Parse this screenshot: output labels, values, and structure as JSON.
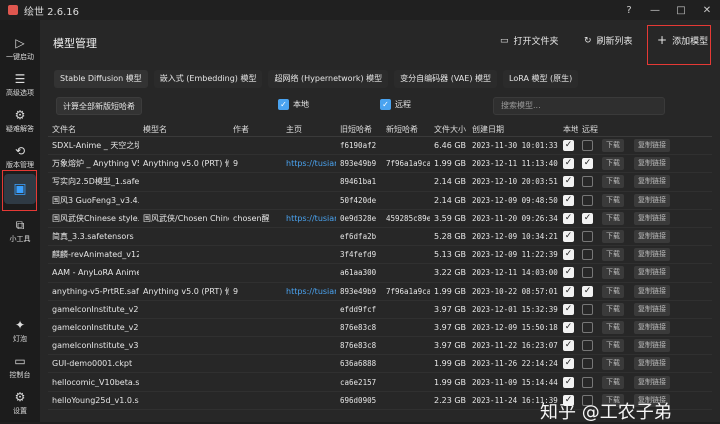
{
  "app": {
    "title": "绘世 2.6.16"
  },
  "window_buttons": [
    "?",
    "—",
    "□",
    "✕"
  ],
  "sidebar": {
    "items": [
      {
        "label": "一键启动",
        "icon": "▷"
      },
      {
        "label": "高级选项",
        "icon": "☰"
      },
      {
        "label": "疑难解答",
        "icon": "⚙"
      },
      {
        "label": "版本管理",
        "icon": "⟲"
      },
      {
        "label": "",
        "icon": "▣"
      },
      {
        "label": "小工具",
        "icon": "⧉"
      }
    ],
    "bottom_items": [
      {
        "label": "灯泡",
        "icon": "✦"
      },
      {
        "label": "控制台",
        "icon": "▭"
      },
      {
        "label": "设置",
        "icon": "⚙"
      }
    ]
  },
  "header": {
    "title": "模型管理",
    "open_folder": "打开文件夹",
    "refresh": "刷新列表",
    "add_model": "添加模型"
  },
  "tabs": [
    "Stable Diffusion 模型",
    "嵌入式 (Embedding) 模型",
    "超网络 (Hypernetwork) 模型",
    "变分自编码器 (VAE) 模型",
    "LoRA 模型 (原生)"
  ],
  "toolbar": {
    "compute_button": "计算全部新版短哈希",
    "local_label": "本地",
    "remote_label": "远程",
    "search_placeholder": "搜索模型..."
  },
  "table": {
    "columns": [
      "文件名",
      "模型名",
      "作者",
      "主页",
      "旧短哈希",
      "新短哈希",
      "文件大小",
      "创建日期",
      "本地",
      "远程",
      "",
      ""
    ],
    "download_label": "下载",
    "copy_label": "复制链接",
    "rows": [
      {
        "file": "SDXL-Anime _ 天空之境",
        "model": "",
        "author": "",
        "home": "",
        "old": "f6190af2",
        "new": "",
        "size": "6.46 GB",
        "date": "2023-11-30 10:01:33",
        "local": true,
        "remote": false
      },
      {
        "file": "万象熔炉 _ Anything V5",
        "model": "Anything v5.0 (PRT) 修复",
        "author": "9",
        "home": "https://tusiart",
        "old": "893e49b9",
        "new": "7f96a1a9ca",
        "size": "1.99 GB",
        "date": "2023-12-11 11:13:40",
        "local": true,
        "remote": true
      },
      {
        "file": "写实向2.5D模型_1.safeten",
        "model": "",
        "author": "",
        "home": "",
        "old": "89461ba1",
        "new": "",
        "size": "2.14 GB",
        "date": "2023-12-10 20:03:51",
        "local": true,
        "remote": false
      },
      {
        "file": "国风3 GuoFeng3_v3.4.saf",
        "model": "",
        "author": "",
        "home": "",
        "old": "50f420de",
        "new": "",
        "size": "2.14 GB",
        "date": "2023-12-09 09:48:50",
        "local": true,
        "remote": false
      },
      {
        "file": "国风武侠Chinese style.ck",
        "model": "国风武侠/Chosen Chine",
        "author": "chosen醒",
        "home": "https://tusiart",
        "old": "0e9d328e",
        "new": "459285c89e",
        "size": "3.59 GB",
        "date": "2023-11-20 09:26:34",
        "local": true,
        "remote": true
      },
      {
        "file": "简真_3.3.safetensors",
        "model": "",
        "author": "",
        "home": "",
        "old": "ef6dfa2b",
        "new": "",
        "size": "5.28 GB",
        "date": "2023-12-09 10:34:21",
        "local": true,
        "remote": false
      },
      {
        "file": "麒麟-revAnimated_v122",
        "model": "",
        "author": "",
        "home": "",
        "old": "3f4fefd9",
        "new": "",
        "size": "5.13 GB",
        "date": "2023-12-09 11:22:39",
        "local": true,
        "remote": false
      },
      {
        "file": "AAM - AnyLoRA Anime",
        "model": "",
        "author": "",
        "home": "",
        "old": "a61aa300",
        "new": "",
        "size": "3.22 GB",
        "date": "2023-12-11 14:03:00",
        "local": true,
        "remote": false
      },
      {
        "file": "anything-v5-PrtRE.safet",
        "model": "Anything v5.0 (PRT) 修复",
        "author": "9",
        "home": "https://tusiart",
        "old": "893e49b9",
        "new": "7f96a1a9ca",
        "size": "1.99 GB",
        "date": "2023-10-22 08:57:01",
        "local": true,
        "remote": true
      },
      {
        "file": "gameIconInstitute_v21.s",
        "model": "",
        "author": "",
        "home": "",
        "old": "efdd9fcf",
        "new": "",
        "size": "3.97 GB",
        "date": "2023-12-01 15:32:39",
        "local": true,
        "remote": false
      },
      {
        "file": "gameIconInstitute_v22.s",
        "model": "",
        "author": "",
        "home": "",
        "old": "876e83c8",
        "new": "",
        "size": "3.97 GB",
        "date": "2023-12-09 15:50:18",
        "local": true,
        "remote": false
      },
      {
        "file": "gameIconInstitute_v30.s",
        "model": "",
        "author": "",
        "home": "",
        "old": "876e83c8",
        "new": "",
        "size": "3.97 GB",
        "date": "2023-11-22 16:23:07",
        "local": true,
        "remote": false
      },
      {
        "file": "GUI-demo0001.ckpt",
        "model": "",
        "author": "",
        "home": "",
        "old": "636a6888",
        "new": "",
        "size": "1.99 GB",
        "date": "2023-11-26 22:14:24",
        "local": true,
        "remote": false
      },
      {
        "file": "hellocomic_V10beta.safe",
        "model": "",
        "author": "",
        "home": "",
        "old": "ca6e2157",
        "new": "",
        "size": "1.99 GB",
        "date": "2023-11-09 15:14:44",
        "local": true,
        "remote": false
      },
      {
        "file": "helloYoung25d_v1.0.safe",
        "model": "",
        "author": "",
        "home": "",
        "old": "696d0905",
        "new": "",
        "size": "2.23 GB",
        "date": "2023-11-24 16:11:39",
        "local": true,
        "remote": false
      }
    ]
  },
  "watermark": "知乎 @工农子弟",
  "colors": {
    "accent": "#4aa3f0",
    "highlight_box": "#e53935",
    "background": "#272727"
  }
}
